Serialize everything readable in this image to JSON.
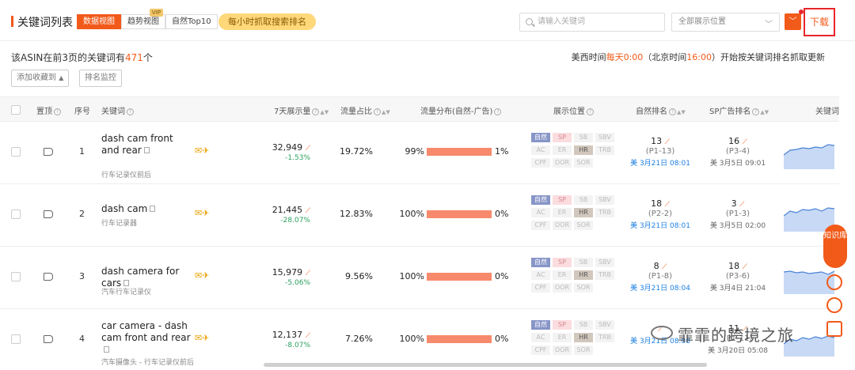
{
  "header": {
    "title": "关键词列表",
    "tabs": [
      {
        "label": "数据视图",
        "active": true
      },
      {
        "label": "趋势视图",
        "vip": "VIP"
      },
      {
        "label": "自然Top10"
      }
    ],
    "hourly_label": "每小时抓取搜索排名",
    "search_placeholder": "请输入关键词",
    "position_select": "全部展示位置",
    "download_label": "下载"
  },
  "summary": {
    "prefix": "该ASIN在前3页的关键词有",
    "count": "471",
    "suffix": "个",
    "notice_a": "美西时间",
    "notice_b": "每天0:00",
    "notice_c": "（北京时间",
    "notice_d": "16:00",
    "notice_e": "）开始按关键词排名抓取更新",
    "add_fav_label": "添加收藏到",
    "rank_monitor_label": "排名监控"
  },
  "table": {
    "columns": {
      "pin": "置顶",
      "index": "序号",
      "keyword": "关键词",
      "impressions": "7天展示量",
      "share": "流量占比",
      "distribution": "流量分布(自然-广告)",
      "placement": "展示位置",
      "organic_rank": "自然排名",
      "sp_rank": "SP广告排名",
      "keyword_trend": "关键词"
    },
    "badge_labels": [
      "自然",
      "SP",
      "SB",
      "SBV",
      "AC",
      "ER",
      "HR",
      "TRB",
      "CPF",
      "OOR",
      "SOR"
    ],
    "rows": [
      {
        "index": "1",
        "keyword": "dash cam front and rear",
        "keyword_cn": "行车记录仪前后",
        "impressions": "32,949",
        "change": "-1.53%",
        "share": "19.72%",
        "dist_left": "99%",
        "dist_right": "1%",
        "organic": "13",
        "organic_page": "(P1-13)",
        "organic_date": "美 3月21日 08:01",
        "sp": "16",
        "sp_page": "(P3-4)",
        "sp_date": "美 3月5日 09:01",
        "active_badges": [
          "自然",
          "SP",
          "HR"
        ]
      },
      {
        "index": "2",
        "keyword": "dash cam",
        "keyword_cn": "行车记录器",
        "impressions": "21,445",
        "change": "-28.07%",
        "share": "12.83%",
        "dist_left": "100%",
        "dist_right": "0%",
        "organic": "18",
        "organic_page": "(P2-2)",
        "organic_date": "美 3月21日 08:01",
        "sp": "3",
        "sp_page": "(P1-3)",
        "sp_date": "美 3月5日 02:00",
        "active_badges": [
          "自然",
          "SP",
          "HR"
        ]
      },
      {
        "index": "3",
        "keyword": "dash camera for cars",
        "keyword_cn": "汽车行车记录仪",
        "impressions": "15,979",
        "change": "-5.06%",
        "share": "9.56%",
        "dist_left": "100%",
        "dist_right": "0%",
        "organic": "8",
        "organic_page": "(P1-8)",
        "organic_date": "美 3月21日 08:04",
        "sp": "18",
        "sp_page": "(P3-6)",
        "sp_date": "美 3月4日 21:04",
        "active_badges": [
          "自然",
          "SP",
          "HR"
        ]
      },
      {
        "index": "4",
        "keyword": "car camera - dash cam front and rear",
        "keyword_cn": "汽车摄像头 - 行车记录仪前后",
        "impressions": "12,137",
        "change": "-8.07%",
        "share": "7.26%",
        "dist_left": "100%",
        "dist_right": "0%",
        "organic": "",
        "organic_page": "",
        "organic_date": "美 3月21日 08:08",
        "sp": "11",
        "sp_page": "(P1-11)",
        "sp_date": "美 3月20日 05:08",
        "active_badges": [
          "自然",
          "SP",
          "HR"
        ]
      }
    ]
  },
  "sidebar": {
    "knowledge_label": "知识库"
  },
  "watermark": "霏霏的跨境之旅",
  "colors": {
    "accent": "#f25a1a",
    "positive": "#2ba15d",
    "date_link": "#1d7fe0",
    "highlight_border": "#e8262a"
  }
}
